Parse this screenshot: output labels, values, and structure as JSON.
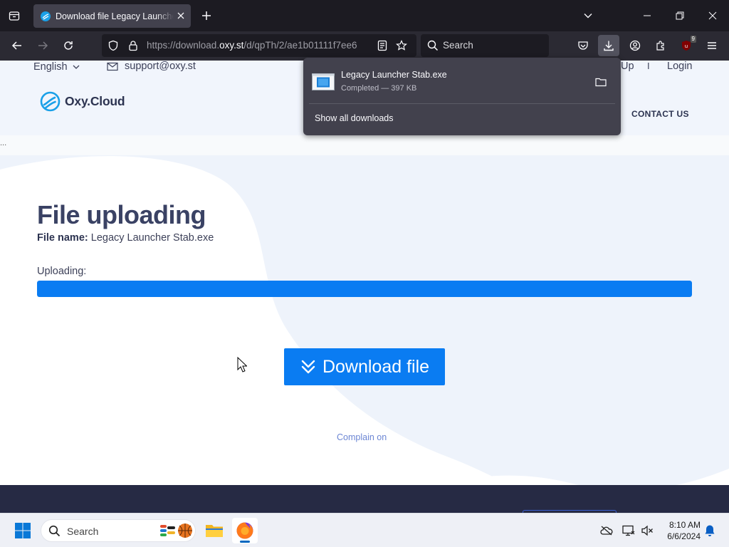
{
  "browser": {
    "tab": {
      "title": "Download file Legacy Launcher Stab.exe"
    },
    "url": {
      "prefix": "https://download.",
      "host": "oxy.st",
      "path": "/d/qpTh/2/ae1b01111f7ee6"
    },
    "search": {
      "placeholder": "Search"
    },
    "extension_badge": "9"
  },
  "downloads_panel": {
    "file_name": "Legacy Launcher Stab.exe",
    "status": "Completed — 397 KB",
    "show_all": "Show all downloads"
  },
  "site": {
    "language": "English",
    "support_email": "support@oxy.st",
    "signup": "Up",
    "separator": "I",
    "login": "Login",
    "logo": "Oxy.Cloud",
    "contact": "CONTACT US",
    "ellipsis": "..."
  },
  "main": {
    "title": "File uploading",
    "file_name_label": "File name:",
    "file_name": "Legacy Launcher Stab.exe",
    "uploading_label": "Uploading:",
    "upload_progress": 1.0,
    "download_button": "Download file",
    "complain": "Complain on"
  },
  "taskbar": {
    "search_label": "Search",
    "time": "8:10 AM",
    "date": "6/6/2024"
  },
  "colors": {
    "accent": "#0a7cf2",
    "heading": "#3a4264",
    "footer": "#262a44"
  }
}
